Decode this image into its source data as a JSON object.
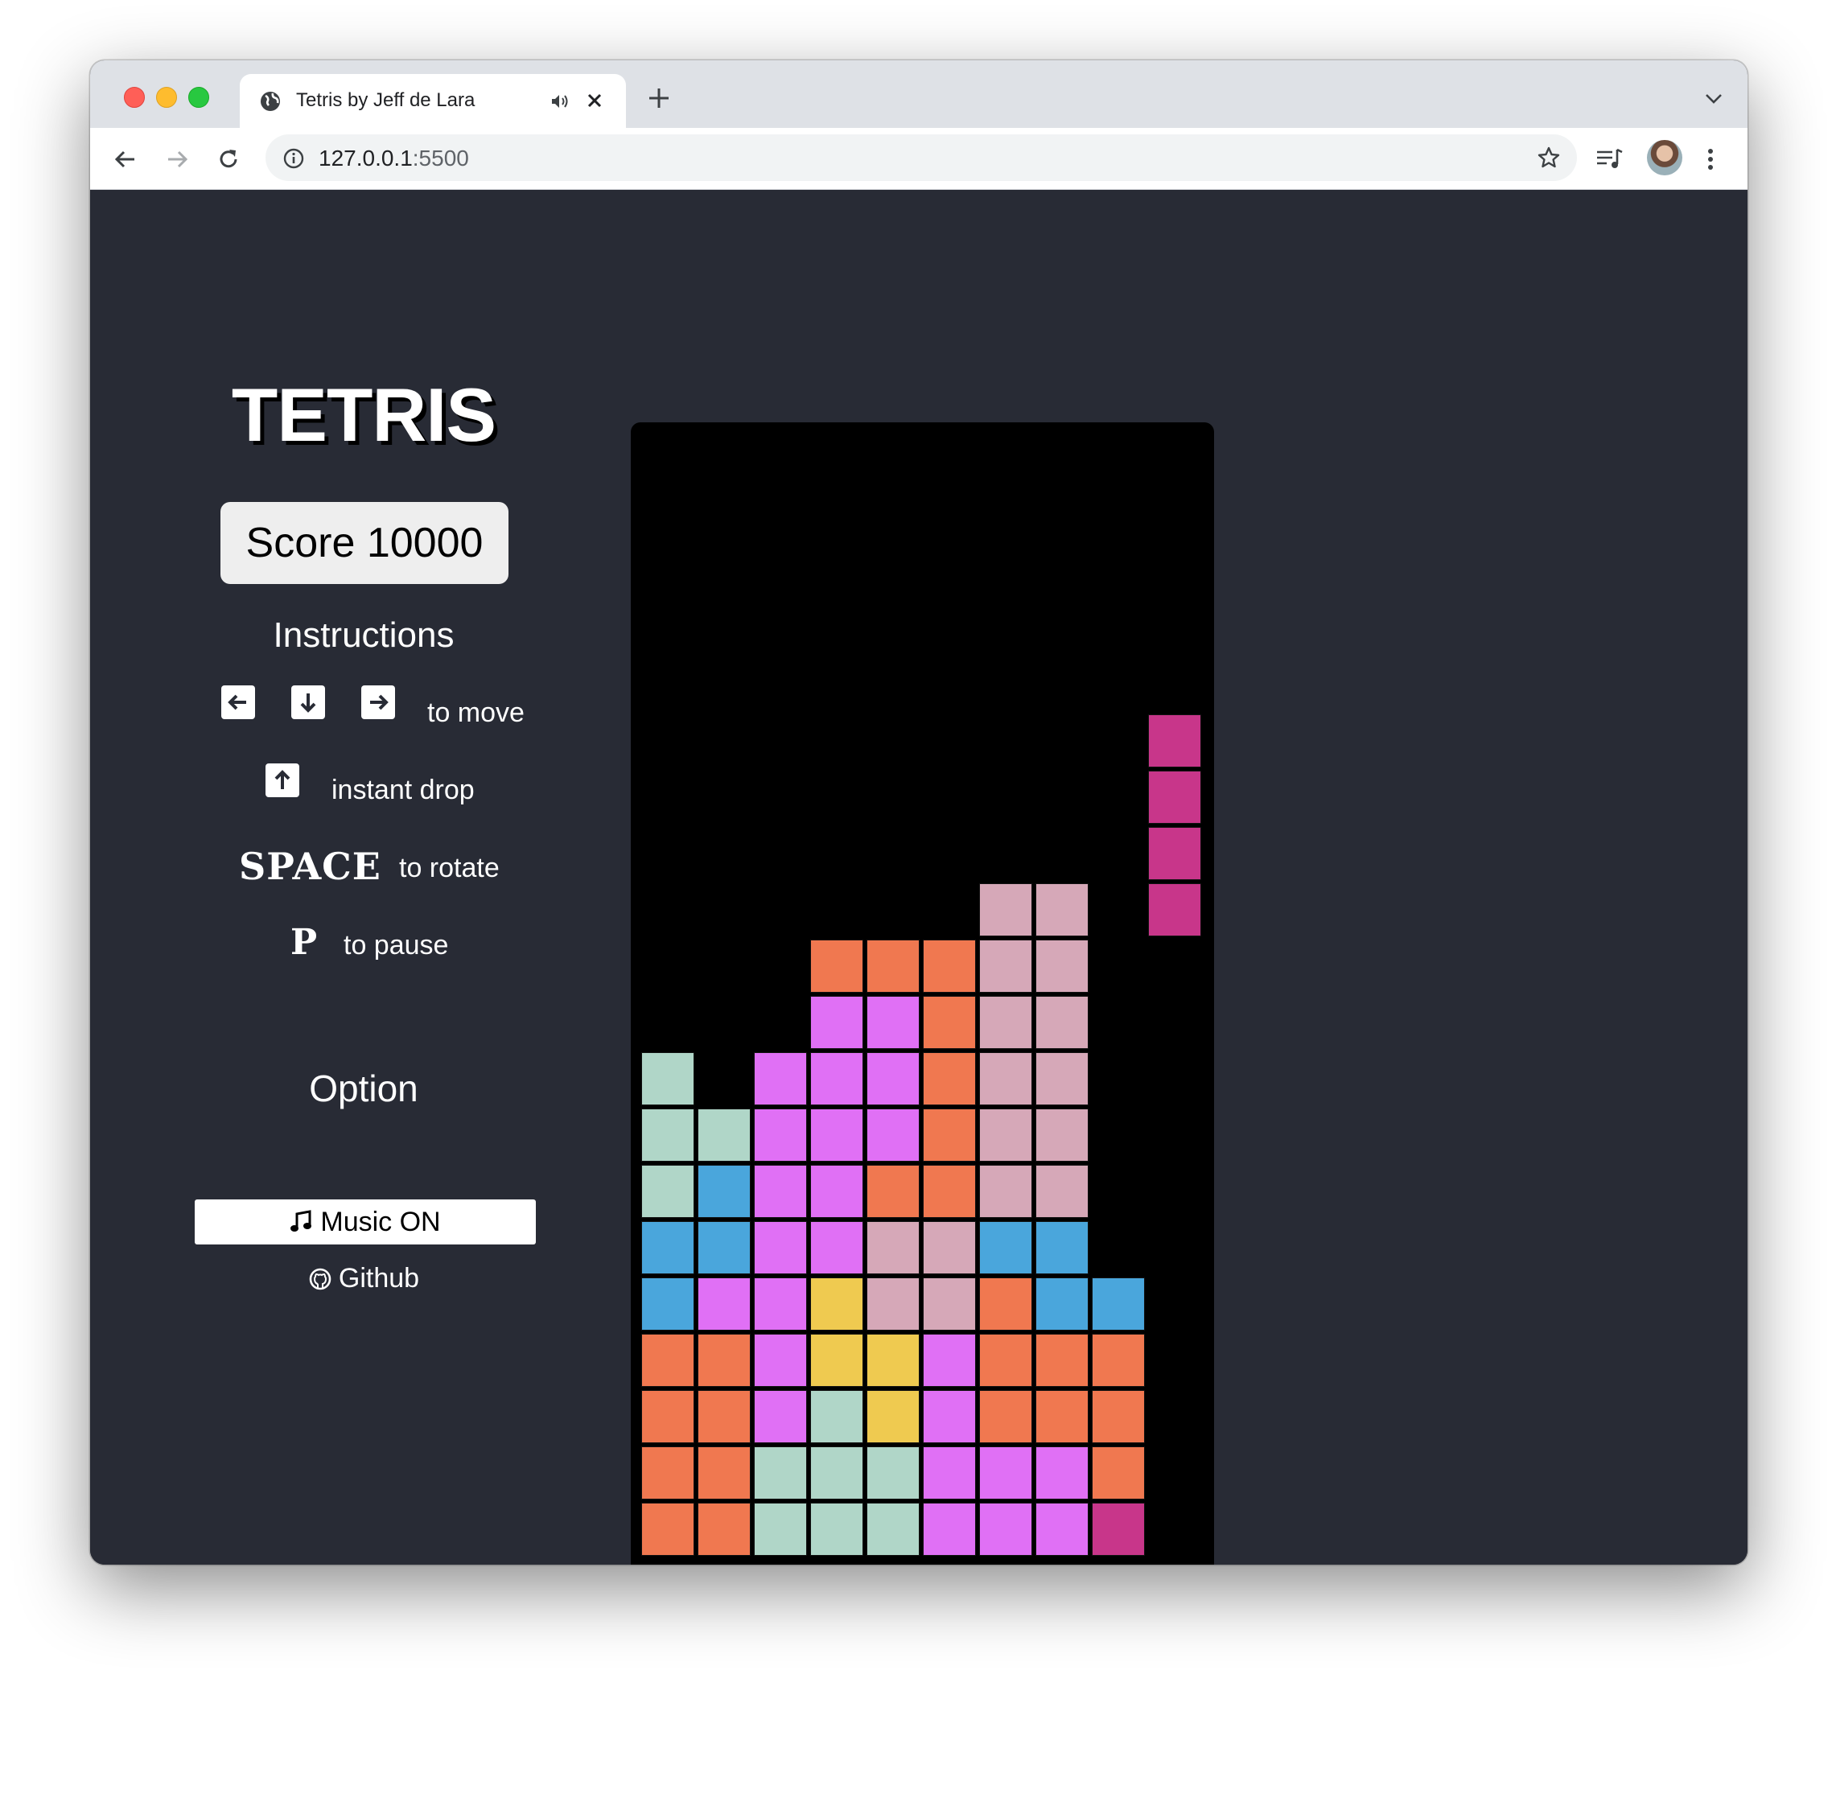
{
  "browser": {
    "tab_title": "Tetris by Jeff de Lara",
    "url_host": "127.0.0.1",
    "url_port": ":5500"
  },
  "page": {
    "title": "TETRIS",
    "score_label": "Score 10000",
    "instructions_heading": "Instructions",
    "move_text": "to move",
    "drop_text": "instant drop",
    "space_key": "SPACE",
    "rotate_text": "to rotate",
    "pause_key": "P",
    "pause_text": "to pause",
    "option_heading": "Option",
    "music_label": "Music ON",
    "github_label": "Github"
  },
  "board": {
    "columns": 10,
    "rows": 20,
    "colors": {
      "O": "#f07850",
      "V": "#e070f5",
      "P": "#d6a8b8",
      "G": "#b0d6c8",
      "B": "#4aa6dc",
      "Y": "#efca50",
      "M": "#c8368a"
    },
    "grid": [
      "..........",
      "..........",
      "..........",
      "..........",
      "..........",
      ".........M",
      ".........M",
      ".........M",
      "......PP.M",
      "...OOOPP..",
      "...VVOPP..",
      "G.VVVOPP..",
      "GGVVVOPP..",
      "GBVVOOPP..",
      "BBVVPPBB..",
      "BVVYPPOBB.",
      "OOVYYVOOO.",
      "OOVGYVOOO.",
      "OOGGGVVVO.",
      "OOGGGVVVM."
    ]
  }
}
